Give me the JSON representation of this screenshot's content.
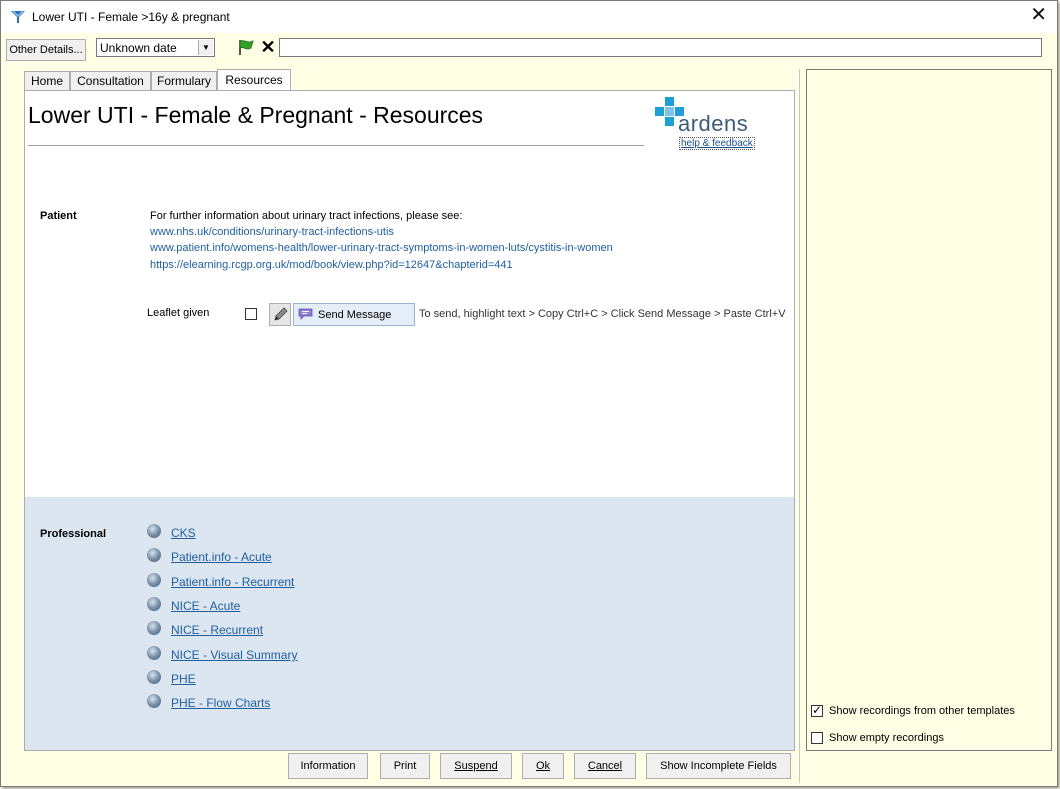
{
  "window": {
    "title": "Lower UTI - Female >16y & pregnant",
    "close_glyph": "✕"
  },
  "toolbar": {
    "other_details_label": "Other Details...",
    "date_value": "Unknown date",
    "date_arrow": "▼",
    "clear_glyph": "✕",
    "search_value": ""
  },
  "tabs": [
    {
      "label": "Home"
    },
    {
      "label": "Consultation"
    },
    {
      "label": "Formulary"
    },
    {
      "label": "Resources",
      "active": true
    }
  ],
  "page": {
    "title": "Lower UTI - Female & Pregnant - Resources",
    "logo_text": "ardens",
    "help_link": "help & feedback"
  },
  "patient": {
    "label": "Patient",
    "intro": "For further information about urinary tract infections, please see:",
    "links": [
      "www.nhs.uk/conditions/urinary-tract-infections-utis",
      "www.patient.info/womens-health/lower-urinary-tract-symptoms-in-women-luts/cystitis-in-women",
      "https://elearning.rcgp.org.uk/mod/book/view.php?id=12647&chapterid=441"
    ],
    "leaflet_label": "Leaflet given",
    "leaflet_checked": false,
    "send_label": "Send Message",
    "send_hint": "To send, highlight text > Copy Ctrl+C > Click Send Message > Paste Ctrl+V"
  },
  "professional": {
    "label": "Professional",
    "links": [
      {
        "label": "CKS"
      },
      {
        "label": "Patient.info - Acute"
      },
      {
        "label": "Patient.info - Recurrent"
      },
      {
        "label": "NICE - Acute"
      },
      {
        "label": "NICE - Recurrent"
      },
      {
        "label": "NICE - Visual Summary"
      },
      {
        "label": "PHE"
      },
      {
        "label": "PHE - Flow Charts"
      }
    ]
  },
  "bottom_buttons": {
    "information": "Information",
    "print": "Print",
    "suspend": "Suspend",
    "ok": "Ok",
    "cancel": "Cancel",
    "show_incomplete": "Show Incomplete Fields"
  },
  "side_panel": {
    "show_other_templates_label": "Show recordings from other templates",
    "show_other_templates_checked": true,
    "show_empty_label": "Show empty recordings",
    "show_empty_checked": false,
    "check_glyph": "✓"
  },
  "colors": {
    "window_bg": "#ffffe6",
    "link": "#1f5fa0",
    "professional_bg": "#dce6f0",
    "logo_blue": "#1e9fd6",
    "logo_text": "#3d5b77"
  }
}
